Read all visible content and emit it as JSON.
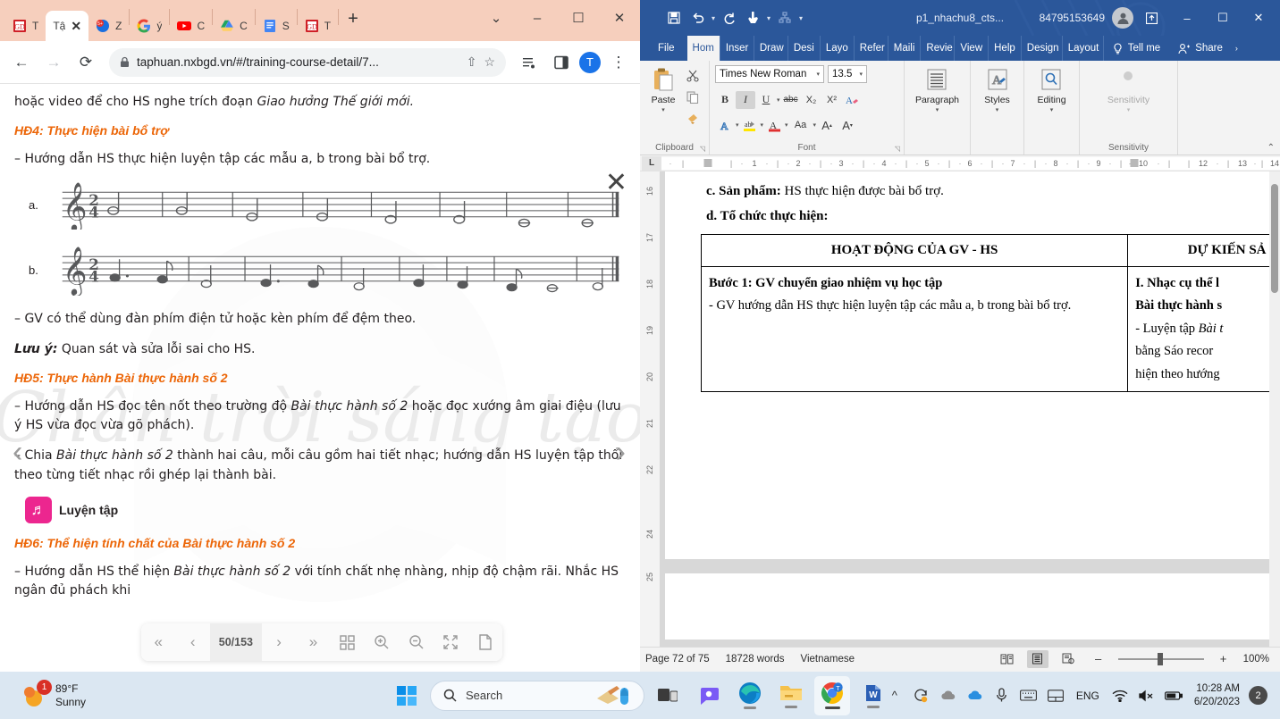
{
  "browser": {
    "tabs": [
      {
        "title": "T",
        "favicon": "book-red-icon",
        "active": false
      },
      {
        "title": "Tậ",
        "favicon": "book-red-icon",
        "active": true
      },
      {
        "title": "Z",
        "favicon": "zalo-icon",
        "active": false
      },
      {
        "title": "ý",
        "favicon": "google-icon",
        "active": false
      },
      {
        "title": "C",
        "favicon": "youtube-icon",
        "active": false
      },
      {
        "title": "C",
        "favicon": "drive-icon",
        "active": false
      },
      {
        "title": "S",
        "favicon": "docs-icon",
        "active": false
      },
      {
        "title": "T",
        "favicon": "book-red-icon",
        "active": false
      }
    ],
    "new_tab_label": "+",
    "tab_close_label": "✕",
    "window": {
      "minimize": "–",
      "maximize": "☐",
      "close": "✕",
      "tabsearch": "⌄"
    },
    "toolbar": {
      "back": "←",
      "forward": "→",
      "reload": "⟳",
      "url": "taphuan.nxbgd.vn/#/training-course-detail/7...",
      "lock_icon": "lock-icon",
      "share": "share-icon",
      "bookmark": "star-icon",
      "reading_list": "reading-list-icon",
      "side_panel": "side-panel-icon",
      "avatar_letter": "T",
      "menu": "⋮"
    }
  },
  "pdf": {
    "close_label": "✕",
    "prev_arrow": "‹",
    "next_arrow": "›",
    "watermark_text": "Chân trời sáng tạo",
    "lines": {
      "l1_pre": "hoặc video để cho HS nghe trích đoạn ",
      "l1_ital": "Giao hưởng Thế giới mới.",
      "hd4": "HĐ4: Thực hiện bài bổ trợ",
      "l2": "– Hướng dẫn HS thực hiện luyện tập các mẫu a, b trong bài bổ trợ.",
      "music_a_label": "a.",
      "music_b_label": "b.",
      "l3": "– GV có thể dùng đàn phím điện tử hoặc kèn phím để đệm theo.",
      "luuy_label": "Lưu ý:",
      "luuy_text": " Quan sát và sửa lỗi sai cho HS.",
      "hd5": "HĐ5: Thực hành Bài thực hành số 2",
      "l4_a": "– Hướng dẫn HS đọc tên nốt theo trường độ ",
      "l4_ital": "Bài thực hành số 2",
      "l4_b": " hoặc đọc xướng âm giai điệu (lưu ý HS vừa đọc vừa gõ phách).",
      "l5_a": "– Chia ",
      "l5_ital": "Bài thực hành số 2",
      "l5_b": " thành hai câu, mỗi câu gồm hai tiết nhạc; hướng dẫn HS luyện tập thổi theo từng tiết nhạc rồi ghép lại thành bài.",
      "luyentap_label": "Luyện tập",
      "luyentap_icon": "music-note-icon",
      "hd6": "HĐ6: Thể hiện tính chất của Bài thực hành số 2",
      "l6_a": "– Hướng dẫn HS thể hiện ",
      "l6_ital": "Bài thực hành số 2",
      "l6_b": " với tính chất nhẹ nhàng, nhịp độ chậm rãi. Nhắc HS ngân đủ phách khi",
      "time_signature": "2/4"
    },
    "toolbar": {
      "first_page": "«",
      "prev_page": "‹",
      "page_indicator": "50/153",
      "next_page": "›",
      "last_page": "»",
      "thumbnails": "grid-icon",
      "zoom_in": "zoom-in-icon",
      "zoom_out": "zoom-out-icon",
      "fullscreen": "expand-icon",
      "single_page": "page-icon"
    }
  },
  "word": {
    "titlebar": {
      "save": "save-icon",
      "undo": "undo-icon",
      "redo": "redo-icon",
      "touch": "touch-mode-icon",
      "customize": "customize-icon",
      "doc_title": "p1_nhachu8_cts...",
      "account_id": "84795153649",
      "avatar": "person-icon",
      "ribbon_display": "ribbon-display-icon",
      "minimize": "–",
      "maximize": "☐",
      "close": "✕"
    },
    "ribbon_tabs": [
      "File",
      "Hom",
      "Inser",
      "Draw",
      "Desi",
      "Layo",
      "Refer",
      "Maili",
      "Revie",
      "View",
      "Help",
      "Design",
      "Layout"
    ],
    "active_ribbon_tab": "Hom",
    "tell_me": "Tell me",
    "share": "Share",
    "ribbon_more": "›",
    "groups": {
      "clipboard": {
        "label": "Clipboard",
        "paste": "Paste",
        "cut_icon": "scissors-icon",
        "copy_icon": "copy-icon",
        "format_painter_icon": "format-painter-icon",
        "dialog": "◹"
      },
      "font": {
        "label": "Font",
        "font_name": "Times New Roman",
        "font_size": "13.5",
        "bold": "B",
        "italic": "I",
        "underline": "U",
        "strikethrough": "abc",
        "subscript": "X₂",
        "superscript": "X²",
        "clear_format": "clear-formatting-icon",
        "text_effects": "A",
        "highlight": "highlight-icon",
        "font_color": "A",
        "change_case": "Aa",
        "grow_font": "A",
        "shrink_font": "A",
        "dialog": "◹"
      },
      "paragraph": {
        "label": "Paragraph",
        "icon": "paragraph-icon"
      },
      "styles": {
        "label": "Styles",
        "icon": "styles-icon"
      },
      "editing": {
        "label": "Editing",
        "icon": "find-icon"
      },
      "sensitivity": {
        "label": "Sensitivity",
        "button": "Sensitivity",
        "icon": "sensitivity-icon"
      }
    },
    "ribbon_collapse": "⌃",
    "ruler_corner": "L",
    "ruler_h_ticks": [
      "1",
      "2",
      "3",
      "4",
      "5",
      "6",
      "7",
      "8",
      "9",
      "10",
      "12",
      "13",
      "14"
    ],
    "ruler_v_ticks": [
      "16",
      "17",
      "18",
      "19",
      "20",
      "21",
      "22",
      "24",
      "25"
    ],
    "document": {
      "line1_bold": "c. Sản phẩm:",
      "line1_rest": " HS thực hiện được bài bổ trợ.",
      "line2": "d. Tổ chức thực hiện:",
      "table": {
        "headers": [
          "HOẠT ĐỘNG CỦA GV - HS",
          "DỰ KIẾN SẢ"
        ],
        "rows": [
          {
            "left_bold": "Bước 1: GV chuyển giao nhiệm vụ học tập",
            "left_body": "- GV hướng dẫn HS thực hiện luyện tập các mẫu a, b trong bài bổ trợ.",
            "right_bold1": "I. Nhạc cụ thể l",
            "right_bold2": "Bài thực hành s",
            "right_body1": "- Luyện tập ",
            "right_body1_ital": "Bài t",
            "right_body2": "bằng  Sáo  recor",
            "right_body3": "hiện theo hướng"
          }
        ]
      }
    },
    "statusbar": {
      "page": "Page 72 of 75",
      "words": "18728 words",
      "language": "Vietnamese",
      "read_mode_icon": "read-mode-icon",
      "print_layout_icon": "print-layout-icon",
      "web_layout_icon": "web-layout-icon",
      "zoom_out": "–",
      "zoom_in": "+",
      "zoom_level": "100%"
    }
  },
  "taskbar": {
    "weather": {
      "temp": "89°F",
      "condition": "Sunny",
      "badge": "1",
      "icon": "sun-icon"
    },
    "start_label": "start-icon",
    "search": {
      "placeholder": "Search",
      "icon": "search-icon"
    },
    "apps": [
      {
        "name": "task-view",
        "icon": "task-view-icon",
        "active": false
      },
      {
        "name": "chat",
        "icon": "chat-icon",
        "active": false
      },
      {
        "name": "edge",
        "icon": "edge-icon",
        "active": false
      },
      {
        "name": "file-explorer",
        "icon": "folder-icon",
        "active": false
      },
      {
        "name": "chrome",
        "icon": "chrome-icon",
        "active": true
      },
      {
        "name": "word",
        "icon": "word-icon",
        "active": false
      }
    ],
    "tray": {
      "overflow": "^",
      "items": [
        "sync-icon",
        "onedrive-gray-icon",
        "onedrive-blue-icon",
        "mic-icon",
        "keyboard-icon",
        "touchpad-icon"
      ],
      "language": "ENG",
      "wifi": "wifi-icon",
      "volume": "volume-mute-icon",
      "battery": "battery-icon",
      "time": "10:28 AM",
      "date": "6/20/2023",
      "notification_count": "2"
    }
  }
}
